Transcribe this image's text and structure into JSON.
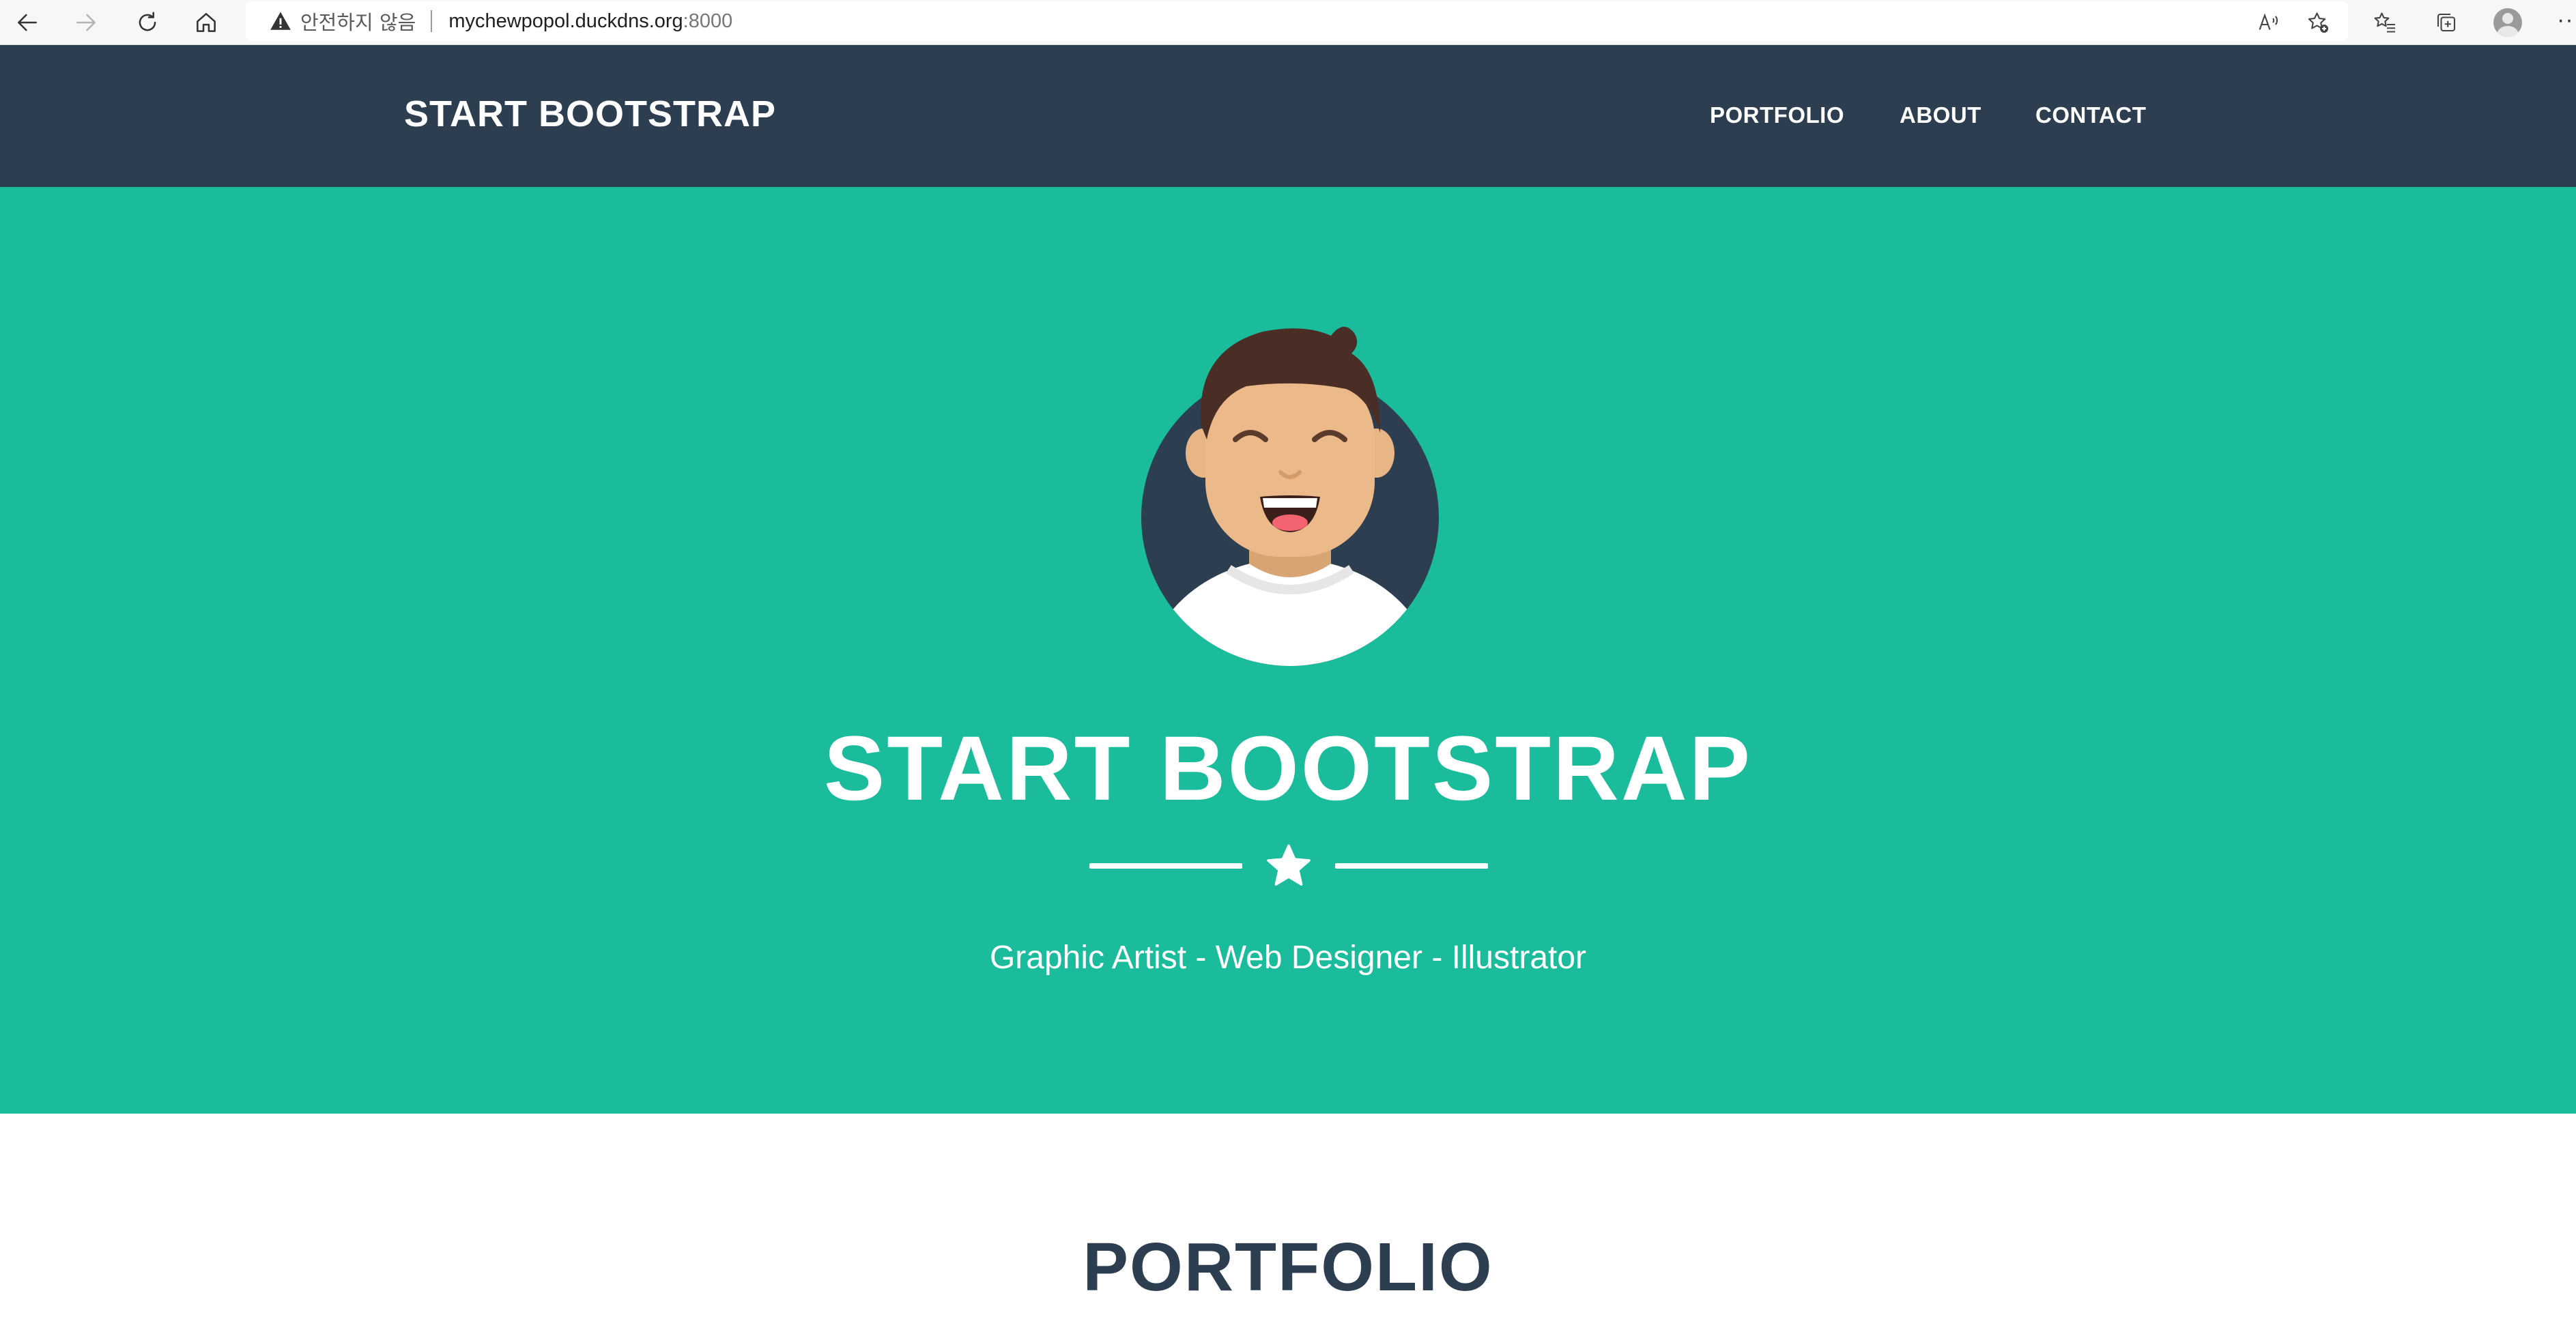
{
  "browser": {
    "not_secure_label": "안전하지 않음",
    "url_host": "mychewpopol.duckdns.org",
    "url_port": ":8000",
    "icons": [
      "back-icon",
      "forward-icon",
      "refresh-icon",
      "home-icon",
      "warning-icon",
      "read-aloud-icon",
      "add-favorite-icon",
      "favorites-icon",
      "collections-icon",
      "profile-icon",
      "more-icon"
    ]
  },
  "navbar": {
    "brand": "START BOOTSTRAP",
    "links": [
      "PORTFOLIO",
      "ABOUT",
      "CONTACT"
    ],
    "background": "#2c3e50"
  },
  "masthead": {
    "title": "START BOOTSTRAP",
    "subtitle": "Graphic Artist - Web Designer - Illustrator",
    "divider_icon": "star-icon",
    "avatar_icon": "avatar-illustration",
    "background": "#1abc9c"
  },
  "portfolio": {
    "heading": "PORTFOLIO",
    "color": "#2c3e50"
  }
}
